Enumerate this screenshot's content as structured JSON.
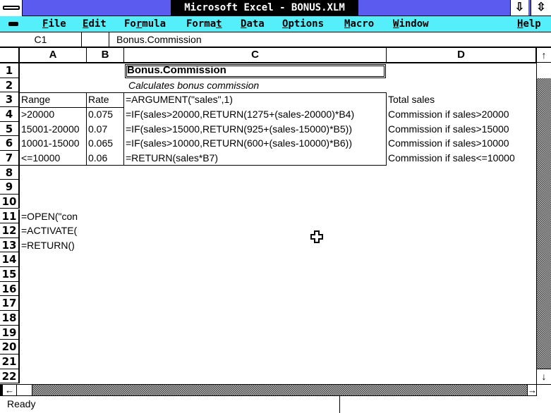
{
  "window": {
    "title": "Microsoft Excel - BONUS.XLM",
    "minimize_glyph": "⇩",
    "restore_glyph": "⇳"
  },
  "menu": {
    "items": [
      {
        "label": "File",
        "hotkey_index": 0
      },
      {
        "label": "Edit",
        "hotkey_index": 0
      },
      {
        "label": "Formula",
        "hotkey_index": 2
      },
      {
        "label": "Format",
        "hotkey_index": 5
      },
      {
        "label": "Data",
        "hotkey_index": 0
      },
      {
        "label": "Options",
        "hotkey_index": 0
      },
      {
        "label": "Macro",
        "hotkey_index": 0
      },
      {
        "label": "Window",
        "hotkey_index": 0
      },
      {
        "label": "Help",
        "hotkey_index": 0
      }
    ]
  },
  "formula_bar": {
    "cell_ref": "C1",
    "content": "Bonus.Commission"
  },
  "sheet": {
    "columns": [
      "A",
      "B",
      "C",
      "D"
    ],
    "row_count": 22,
    "active_cell": "C1",
    "cells": [
      {
        "ref": "C1",
        "row": 1,
        "col": "C",
        "value": "Bonus.Commission",
        "style": "bold"
      },
      {
        "ref": "C2",
        "row": 2,
        "col": "C",
        "value": "Calculates bonus commission",
        "style": "italic"
      },
      {
        "ref": "A3",
        "row": 3,
        "col": "A",
        "value": "Range"
      },
      {
        "ref": "B3",
        "row": 3,
        "col": "B",
        "value": "Rate"
      },
      {
        "ref": "C3",
        "row": 3,
        "col": "C",
        "value": "=ARGUMENT(\"sales\",1)"
      },
      {
        "ref": "D3",
        "row": 3,
        "col": "D",
        "value": "Total sales"
      },
      {
        "ref": "A4",
        "row": 4,
        "col": "A",
        "value": ">20000"
      },
      {
        "ref": "B4",
        "row": 4,
        "col": "B",
        "value": "0.075"
      },
      {
        "ref": "C4",
        "row": 4,
        "col": "C",
        "value": "=IF(sales>20000,RETURN(1275+(sales-20000)*B4)"
      },
      {
        "ref": "D4",
        "row": 4,
        "col": "D",
        "value": "Commission if sales>20000"
      },
      {
        "ref": "A5",
        "row": 5,
        "col": "A",
        "value": "15001-20000"
      },
      {
        "ref": "B5",
        "row": 5,
        "col": "B",
        "value": "0.07"
      },
      {
        "ref": "C5",
        "row": 5,
        "col": "C",
        "value": "=IF(sales>15000,RETURN(925+(sales-15000)*B5))"
      },
      {
        "ref": "D5",
        "row": 5,
        "col": "D",
        "value": "Commission if sales>15000"
      },
      {
        "ref": "A6",
        "row": 6,
        "col": "A",
        "value": "10001-15000"
      },
      {
        "ref": "B6",
        "row": 6,
        "col": "B",
        "value": "0.065"
      },
      {
        "ref": "C6",
        "row": 6,
        "col": "C",
        "value": "=IF(sales>10000,RETURN(600+(sales-10000)*B6))"
      },
      {
        "ref": "D6",
        "row": 6,
        "col": "D",
        "value": "Commission if sales>10000"
      },
      {
        "ref": "A7",
        "row": 7,
        "col": "A",
        "value": "<=10000"
      },
      {
        "ref": "B7",
        "row": 7,
        "col": "B",
        "value": "0.06"
      },
      {
        "ref": "C7",
        "row": 7,
        "col": "C",
        "value": "=RETURN(sales*B7)"
      },
      {
        "ref": "D7",
        "row": 7,
        "col": "D",
        "value": "Commission if sales<=10000"
      },
      {
        "ref": "A11",
        "row": 11,
        "col": "A",
        "value": "=OPEN(\"con"
      },
      {
        "ref": "A12",
        "row": 12,
        "col": "A",
        "value": "=ACTIVATE("
      },
      {
        "ref": "A13",
        "row": 13,
        "col": "A",
        "value": "=RETURN()"
      }
    ]
  },
  "status_bar": {
    "text": "Ready"
  },
  "colors": {
    "title_bar": "#5b5bf0",
    "menu_bar": "#55eefb",
    "title_text_bg": "#000000"
  }
}
